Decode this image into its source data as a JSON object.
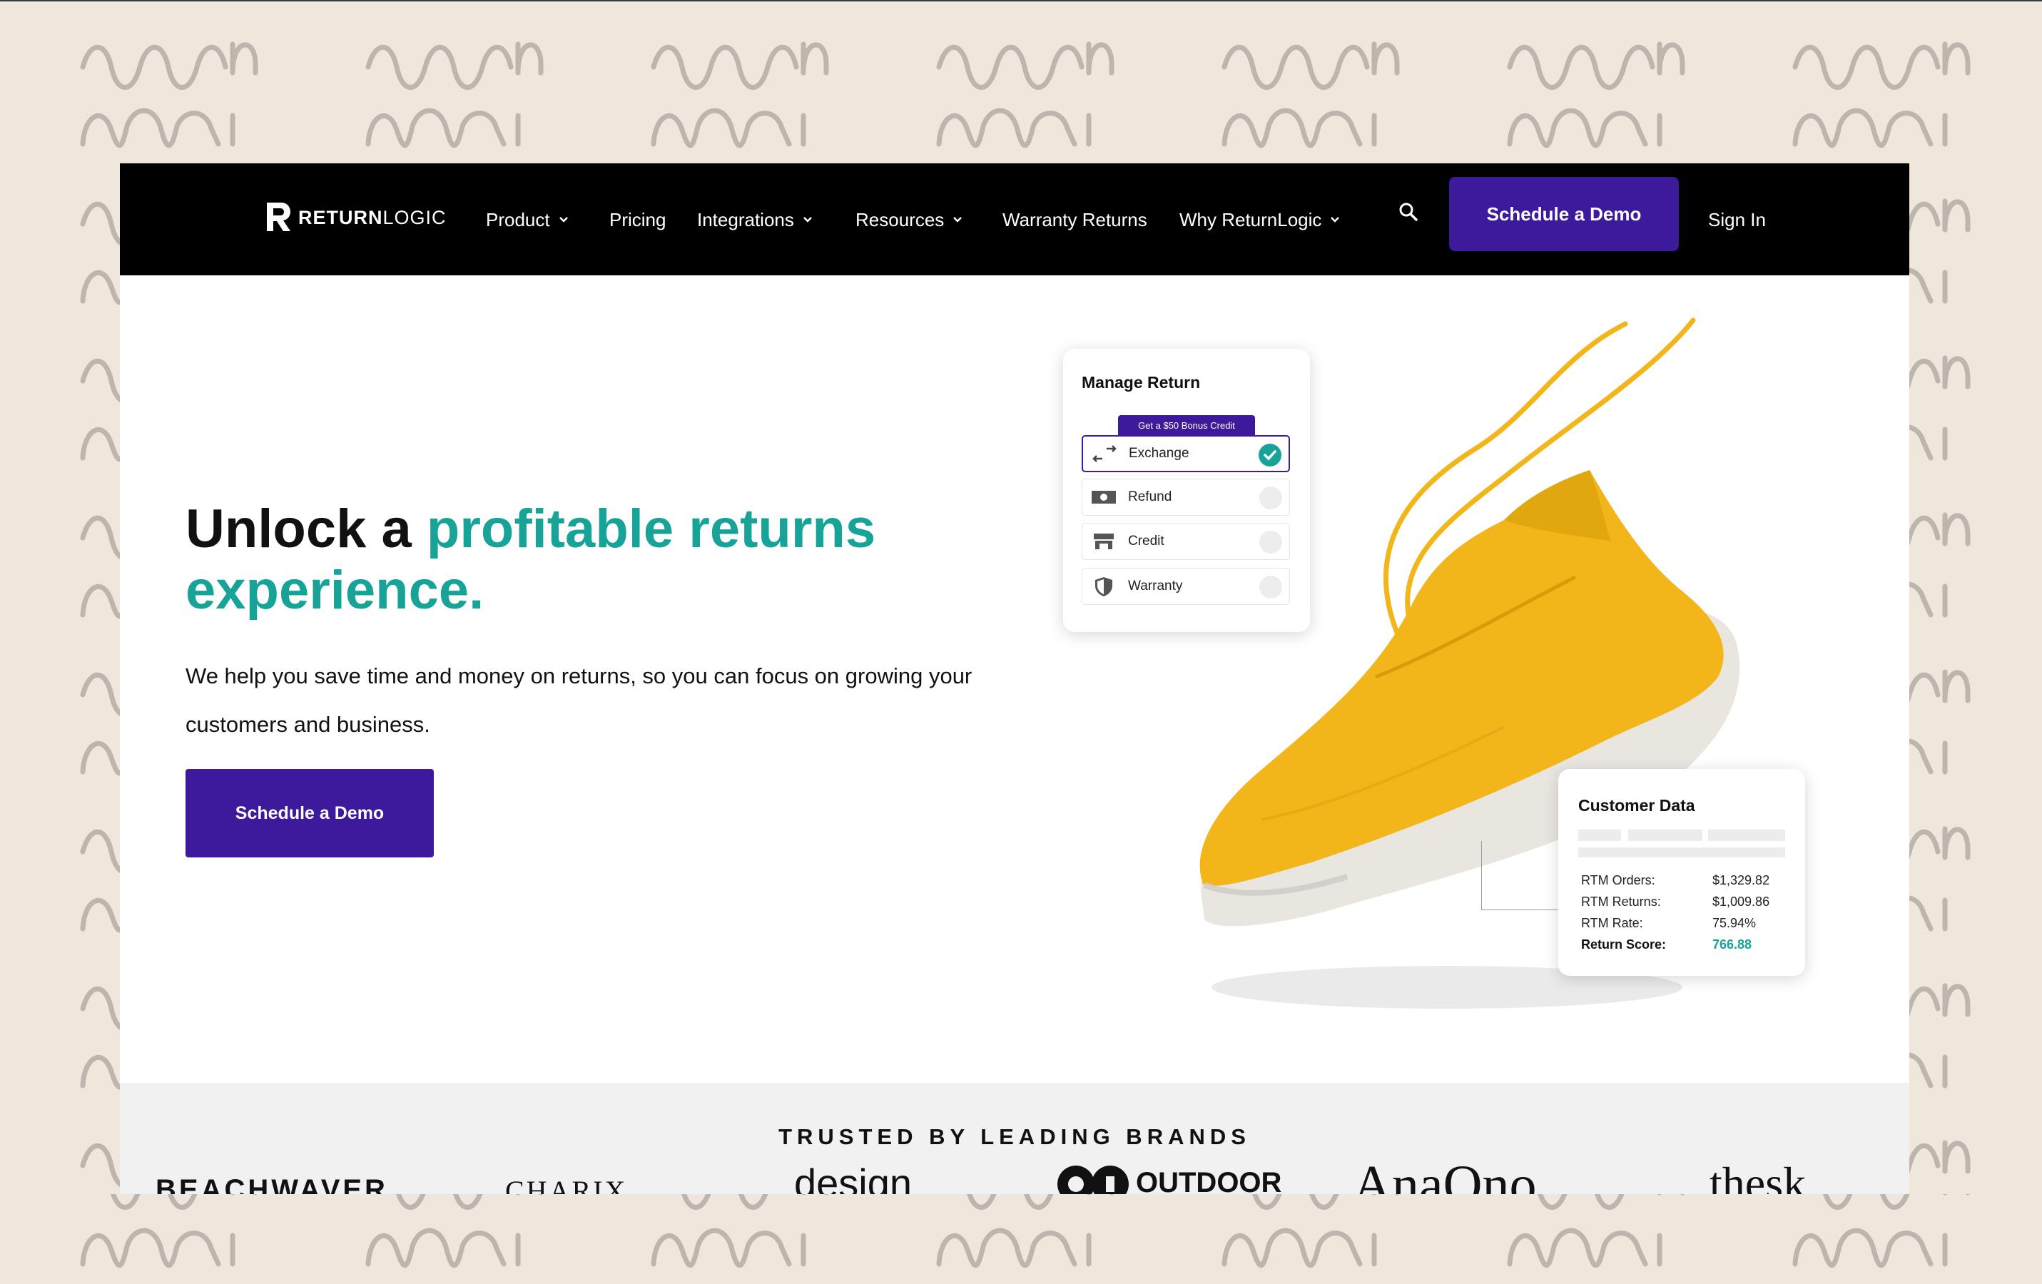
{
  "nav": {
    "logo_bold": "RETURN",
    "logo_light": "LOGIC",
    "items": [
      {
        "label": "Product"
      },
      {
        "label": "Pricing"
      },
      {
        "label": "Integrations"
      },
      {
        "label": "Resources"
      },
      {
        "label": "Warranty Returns"
      },
      {
        "label": "Why ReturnLogic"
      }
    ],
    "cta_label": "Schedule a Demo",
    "signin_label": "Sign In"
  },
  "hero": {
    "title_dark": "Unlock a ",
    "title_teal": "profitable returns experience.",
    "subtitle": "We help you save time and money on returns, so you can focus on growing your customers and business.",
    "cta_label": "Schedule a Demo"
  },
  "manage_return": {
    "title": "Manage Return",
    "bonus": "Get a $50 Bonus Credit",
    "options": [
      {
        "label": "Exchange",
        "icon": "exchange-arrows-icon",
        "selected": true
      },
      {
        "label": "Refund",
        "icon": "cash-icon",
        "selected": false
      },
      {
        "label": "Credit",
        "icon": "store-icon",
        "selected": false
      },
      {
        "label": "Warranty",
        "icon": "shield-icon",
        "selected": false
      }
    ]
  },
  "customer_data": {
    "title": "Customer Data",
    "rows": [
      {
        "key": "RTM Orders:",
        "value": "$1,329.82"
      },
      {
        "key": "RTM Returns:",
        "value": "$1,009.86"
      },
      {
        "key": "RTM Rate:",
        "value": "75.94%"
      },
      {
        "key": "Return Score:",
        "value": "766.88"
      }
    ]
  },
  "trusted": {
    "heading": "TRUSTED BY LEADING BRANDS",
    "brands": [
      "BEACHWAVER",
      "CHARIX",
      "design",
      "OUTDOOR",
      "AnaOno",
      "thesk"
    ]
  },
  "colors": {
    "brand_purple": "#3c1a9b",
    "teal": "#17a398",
    "shoe_yellow": "#f2b61a",
    "background": "#efe6dc"
  }
}
